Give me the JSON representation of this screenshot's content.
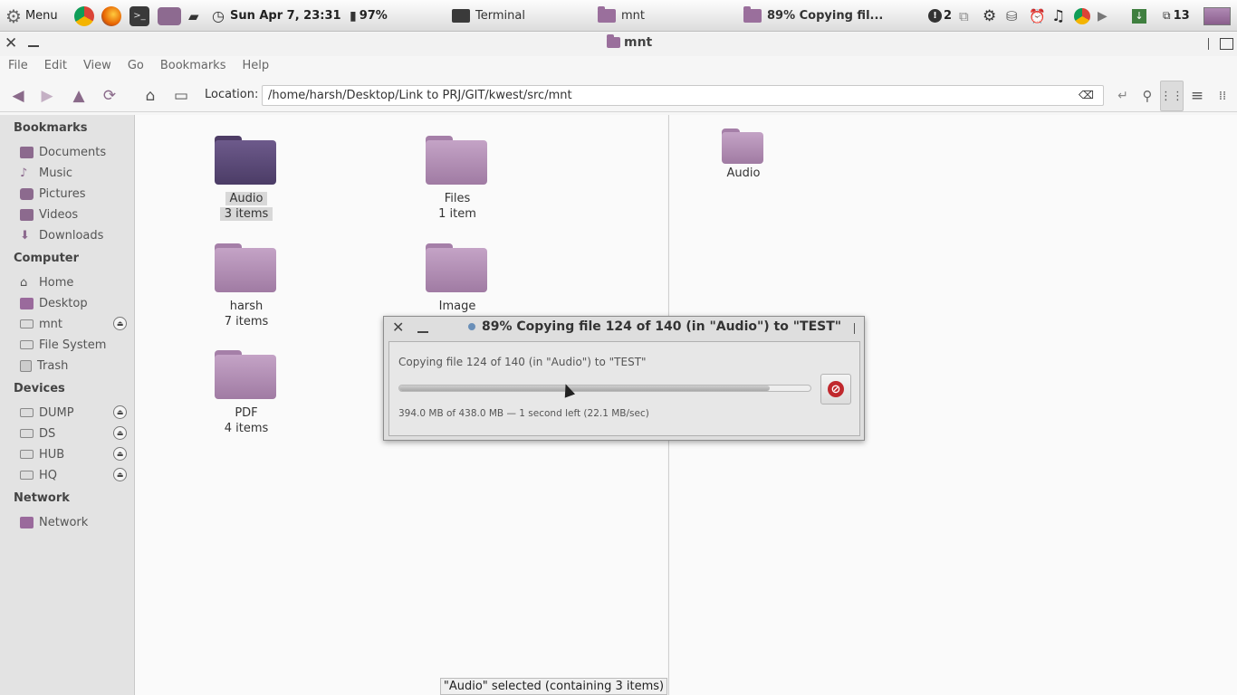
{
  "panel": {
    "menu_label": "Menu",
    "clock": "Sun Apr  7, 23:31",
    "battery": "97%",
    "tasks": [
      "Terminal",
      "mnt",
      "89% Copying fil..."
    ],
    "alert_count": "2",
    "workspace_count": "13"
  },
  "window": {
    "title": "mnt",
    "menus": [
      "File",
      "Edit",
      "View",
      "Go",
      "Bookmarks",
      "Help"
    ]
  },
  "toolbar": {
    "location_label": "Location:",
    "location_value": "/home/harsh/Desktop/Link to PRJ/GIT/kwest/src/mnt"
  },
  "sidebar": {
    "sections": [
      "Bookmarks",
      "Computer",
      "Devices",
      "Network"
    ],
    "bookmarks": [
      "Documents",
      "Music",
      "Pictures",
      "Videos",
      "Downloads"
    ],
    "computer": [
      "Home",
      "Desktop",
      "mnt",
      "File System",
      "Trash"
    ],
    "devices": [
      "DUMP",
      "DS",
      "HUB",
      "HQ"
    ],
    "network": [
      "Network"
    ]
  },
  "left_pane": {
    "items": [
      {
        "name": "Audio",
        "count": "3 items"
      },
      {
        "name": "Files",
        "count": "1 item"
      },
      {
        "name": "harsh",
        "count": "7 items"
      },
      {
        "name": "Image",
        "count": ""
      },
      {
        "name": "PDF",
        "count": "4 items"
      }
    ]
  },
  "right_pane": {
    "items": [
      {
        "name": "Audio"
      }
    ]
  },
  "dialog": {
    "title": "89% Copying file 124 of 140 (in \"Audio\") to \"TEST\"",
    "message": "Copying file 124 of 140 (in \"Audio\") to \"TEST\"",
    "progress_fraction": 0.9,
    "details": "394.0 MB of 438.0 MB — 1 second left (22.1 MB/sec)"
  },
  "status": "\"Audio\" selected (containing 3 items)",
  "colors": {
    "folder": "#a07ba3",
    "folder_selected": "#5e4a78",
    "accent": "#8a6a8a",
    "cancel_red": "#c0282d"
  }
}
